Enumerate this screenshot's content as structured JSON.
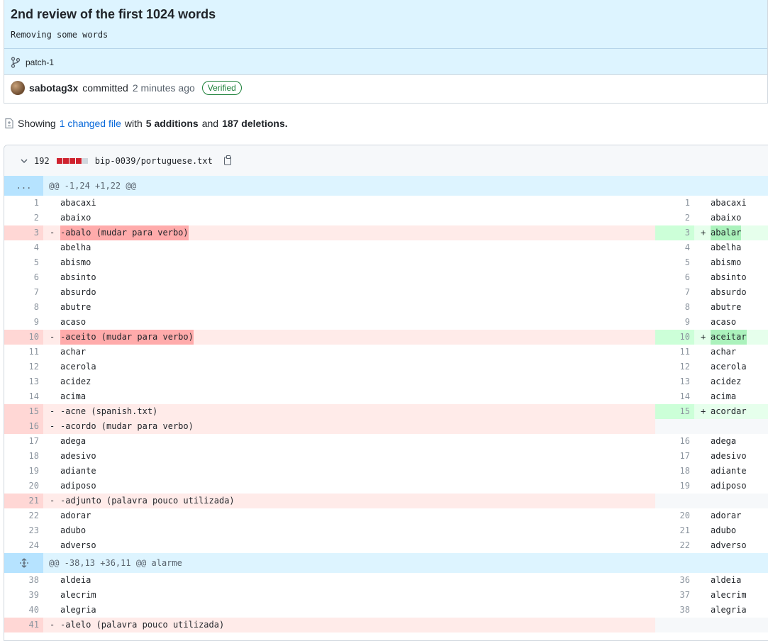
{
  "commit": {
    "title": "2nd review of the first 1024 words",
    "description": "Removing some words",
    "branch": "patch-1",
    "author": "sabotag3x",
    "committed": "committed",
    "time": "2 minutes ago",
    "verified": "Verified"
  },
  "summary": {
    "showing": "Showing",
    "changed": "1 changed file",
    "with": "with",
    "additions": "5 additions",
    "and": "and",
    "deletions": "187 deletions."
  },
  "file": {
    "count": "192",
    "name": "bip-0039/portuguese.txt"
  },
  "hunks": [
    {
      "expander": "...",
      "header": "@@ -1,24 +1,22 @@",
      "rows": [
        {
          "type": "ctx",
          "l": "1",
          "lt": "abacaxi",
          "r": "1",
          "rt": "abacaxi"
        },
        {
          "type": "ctx",
          "l": "2",
          "lt": "abaixo",
          "r": "2",
          "rt": "abaixo"
        },
        {
          "type": "chg",
          "l": "3",
          "lt": "-abalo (mudar para verbo)",
          "r": "3",
          "rt": "abalar"
        },
        {
          "type": "ctx",
          "l": "4",
          "lt": "abelha",
          "r": "4",
          "rt": "abelha"
        },
        {
          "type": "ctx",
          "l": "5",
          "lt": "abismo",
          "r": "5",
          "rt": "abismo"
        },
        {
          "type": "ctx",
          "l": "6",
          "lt": "absinto",
          "r": "6",
          "rt": "absinto"
        },
        {
          "type": "ctx",
          "l": "7",
          "lt": "absurdo",
          "r": "7",
          "rt": "absurdo"
        },
        {
          "type": "ctx",
          "l": "8",
          "lt": "abutre",
          "r": "8",
          "rt": "abutre"
        },
        {
          "type": "ctx",
          "l": "9",
          "lt": "acaso",
          "r": "9",
          "rt": "acaso"
        },
        {
          "type": "chg",
          "l": "10",
          "lt": "-aceito (mudar para verbo)",
          "r": "10",
          "rt": "aceitar"
        },
        {
          "type": "ctx",
          "l": "11",
          "lt": "achar",
          "r": "11",
          "rt": "achar"
        },
        {
          "type": "ctx",
          "l": "12",
          "lt": "acerola",
          "r": "12",
          "rt": "acerola"
        },
        {
          "type": "ctx",
          "l": "13",
          "lt": "acidez",
          "r": "13",
          "rt": "acidez"
        },
        {
          "type": "ctx",
          "l": "14",
          "lt": "acima",
          "r": "14",
          "rt": "acima"
        },
        {
          "type": "chg2",
          "l": "15",
          "lt": "-acne (spanish.txt)",
          "r": "15",
          "rt": "acordar"
        },
        {
          "type": "del",
          "l": "16",
          "lt": "-acordo (mudar para verbo)"
        },
        {
          "type": "ctx",
          "l": "17",
          "lt": "adega",
          "r": "16",
          "rt": "adega"
        },
        {
          "type": "ctx",
          "l": "18",
          "lt": "adesivo",
          "r": "17",
          "rt": "adesivo"
        },
        {
          "type": "ctx",
          "l": "19",
          "lt": "adiante",
          "r": "18",
          "rt": "adiante"
        },
        {
          "type": "ctx",
          "l": "20",
          "lt": "adiposo",
          "r": "19",
          "rt": "adiposo"
        },
        {
          "type": "del",
          "l": "21",
          "lt": "-adjunto (palavra pouco utilizada)"
        },
        {
          "type": "ctx",
          "l": "22",
          "lt": "adorar",
          "r": "20",
          "rt": "adorar"
        },
        {
          "type": "ctx",
          "l": "23",
          "lt": "adubo",
          "r": "21",
          "rt": "adubo"
        },
        {
          "type": "ctx",
          "l": "24",
          "lt": "adverso",
          "r": "22",
          "rt": "adverso"
        }
      ]
    },
    {
      "expander": "expand-icon",
      "header": "@@ -38,13 +36,11 @@ alarme",
      "rows": [
        {
          "type": "ctx",
          "l": "38",
          "lt": "aldeia",
          "r": "36",
          "rt": "aldeia"
        },
        {
          "type": "ctx",
          "l": "39",
          "lt": "alecrim",
          "r": "37",
          "rt": "alecrim"
        },
        {
          "type": "ctx",
          "l": "40",
          "lt": "alegria",
          "r": "38",
          "rt": "alegria"
        },
        {
          "type": "del",
          "l": "41",
          "lt": "-alelo (palavra pouco utilizada)"
        }
      ]
    }
  ]
}
